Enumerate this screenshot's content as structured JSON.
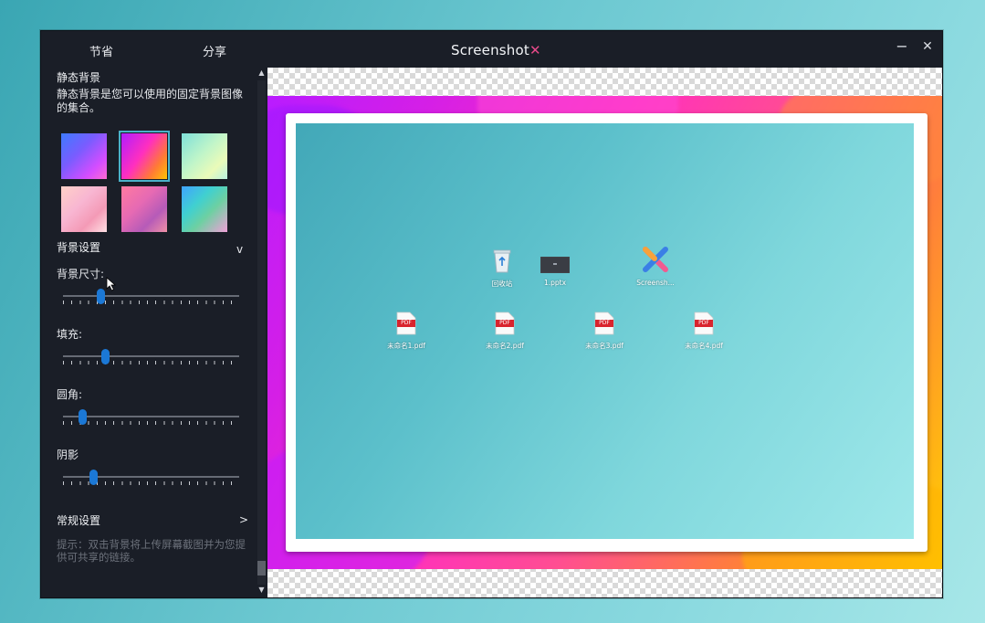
{
  "window": {
    "nav_tabs": [
      "节省",
      "分享"
    ],
    "title": "Screenshot",
    "title_mark": "✕",
    "minimize": "−",
    "close": "✕"
  },
  "sidebar": {
    "static_bg_title": "静态背景",
    "static_bg_desc": "静态背景是您可以使用的固定背景图像的集合。",
    "thumbnails": [
      {
        "name": "bg-blue-purple",
        "selected": false
      },
      {
        "name": "bg-magenta-orange",
        "selected": true
      },
      {
        "name": "bg-mint-green",
        "selected": false
      },
      {
        "name": "bg-pastel-pink",
        "selected": false
      },
      {
        "name": "bg-rose-purple",
        "selected": false
      },
      {
        "name": "bg-blue-rainbow",
        "selected": false
      }
    ],
    "bg_settings_title": "背景设置",
    "bg_settings_chevron": "v",
    "sliders": [
      {
        "label": "背景尺寸:",
        "value": 0.2
      },
      {
        "label": "填充:",
        "value": 0.23
      },
      {
        "label": "圆角:",
        "value": 0.09
      },
      {
        "label": "阴影",
        "value": 0.16
      }
    ],
    "general_settings_title": "常规设置",
    "general_settings_chevron": ">",
    "tip": "提示：双击背景将上传屏幕截图并为您提供可共享的链接。"
  },
  "scrollbar": {
    "up": "▲",
    "down": "▼"
  },
  "preview": {
    "desktop_icons": [
      {
        "label": "回收站",
        "type": "recycle-bin"
      },
      {
        "label": "1.pptx",
        "type": "pptx"
      },
      {
        "label": "Screensh...",
        "type": "screenshotx"
      },
      {
        "label": "未命名1.pdf",
        "type": "pdf"
      },
      {
        "label": "未命名2.pdf",
        "type": "pdf"
      },
      {
        "label": "未命名3.pdf",
        "type": "pdf"
      },
      {
        "label": "未命名4.pdf",
        "type": "pdf"
      }
    ],
    "pdf_badge": "PDF"
  }
}
